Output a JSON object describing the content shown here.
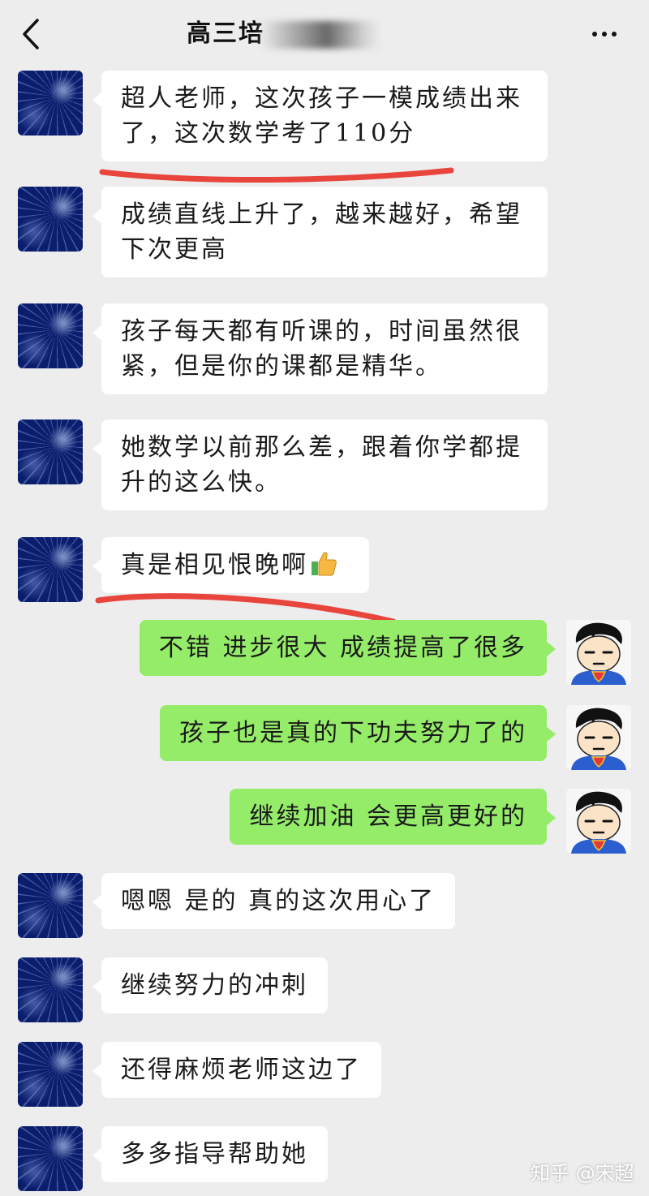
{
  "header": {
    "title": "高三培",
    "back_icon": "chevron-left-icon",
    "more_icon": "more-dots-icon"
  },
  "messages": [
    {
      "side": "in",
      "text": "超人老师，这次孩子一模成绩出来了，这次数学考了110分",
      "underlined": true
    },
    {
      "side": "in",
      "text": "成绩直线上升了，越来越好，希望下次更高"
    },
    {
      "side": "in",
      "text": "孩子每天都有听课的，时间虽然很紧，但是你的课都是精华。"
    },
    {
      "side": "in",
      "text": "她数学以前那么差，跟着你学都提升的这么快。"
    },
    {
      "side": "in",
      "text": "真是相见恨晚啊",
      "emoji": "thumbs-up-icon",
      "underlined": true
    },
    {
      "side": "out",
      "text": "不错 进步很大 成绩提高了很多"
    },
    {
      "side": "out",
      "text": "孩子也是真的下功夫努力了的"
    },
    {
      "side": "out",
      "text": "继续加油 会更高更好的"
    },
    {
      "side": "in",
      "text": "嗯嗯 是的 真的这次用心了"
    },
    {
      "side": "in",
      "text": "继续努力的冲刺"
    },
    {
      "side": "in",
      "text": "还得麻烦老师这边了"
    },
    {
      "side": "in",
      "text": "多多指导帮助她"
    }
  ],
  "watermark": "知乎 @宋超",
  "colors": {
    "background": "#ededed",
    "incoming_bubble": "#ffffff",
    "outgoing_bubble": "#95ec69",
    "underline": "#e8453c"
  }
}
